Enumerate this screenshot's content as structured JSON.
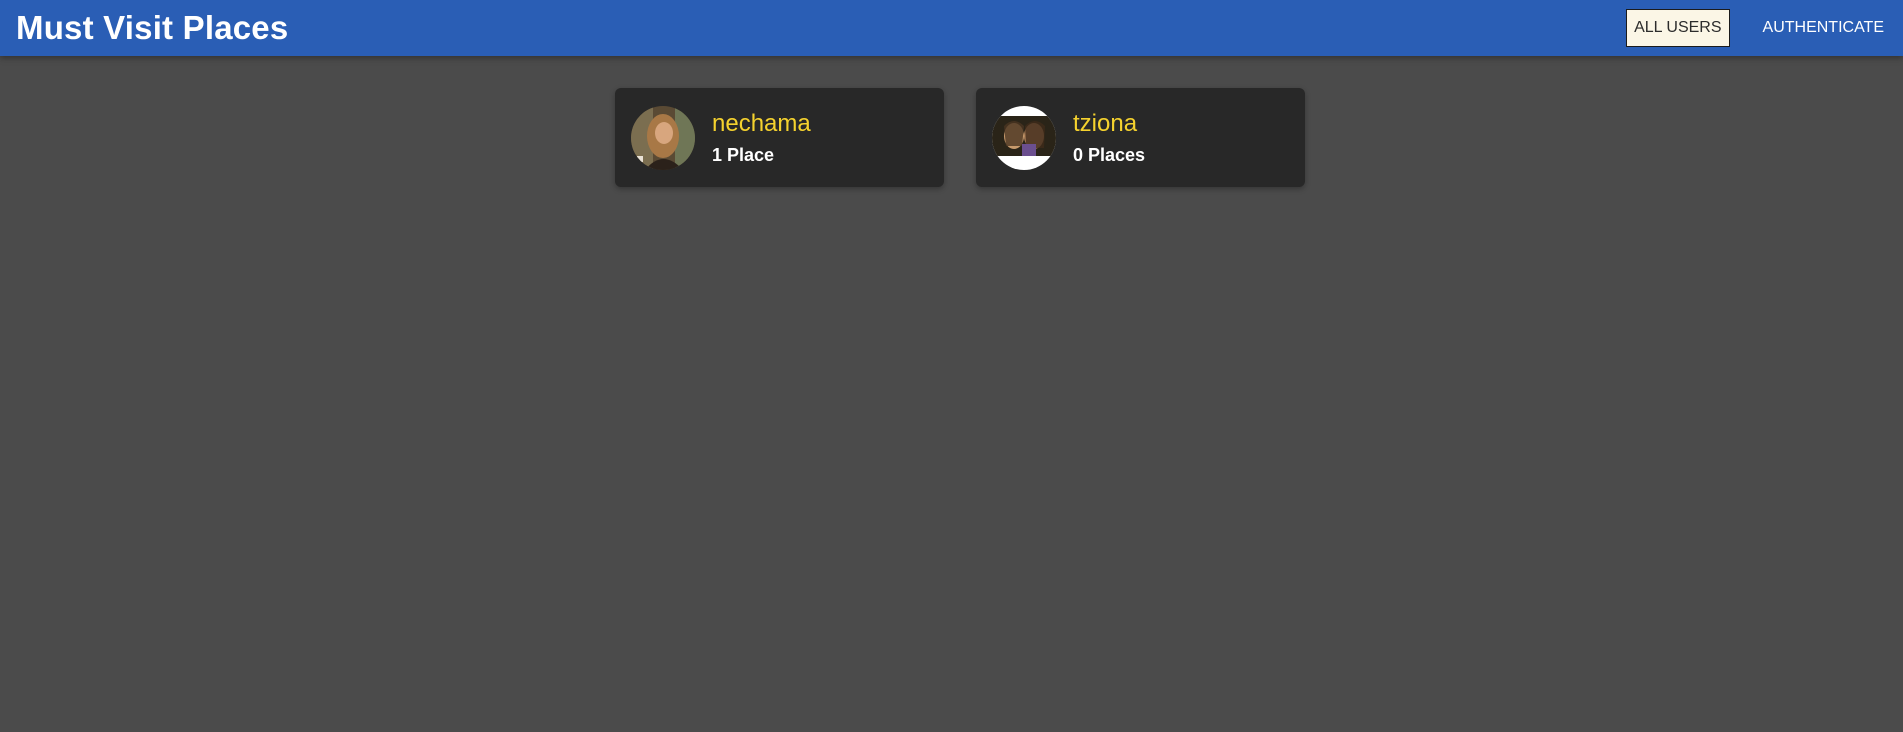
{
  "header": {
    "title": "Must Visit Places",
    "nav": [
      {
        "label": "ALL USERS",
        "active": true
      },
      {
        "label": "AUTHENTICATE",
        "active": false
      }
    ]
  },
  "users": [
    {
      "name": "nechama",
      "places": "1 Place",
      "avatar_icon": "user-photo"
    },
    {
      "name": "tziona",
      "places": "0 Places",
      "avatar_icon": "user-photo"
    }
  ],
  "colors": {
    "header_bg": "#2a5eb5",
    "page_bg": "#4b4b4b",
    "card_bg": "#282828",
    "name_accent": "#f5d22e"
  }
}
